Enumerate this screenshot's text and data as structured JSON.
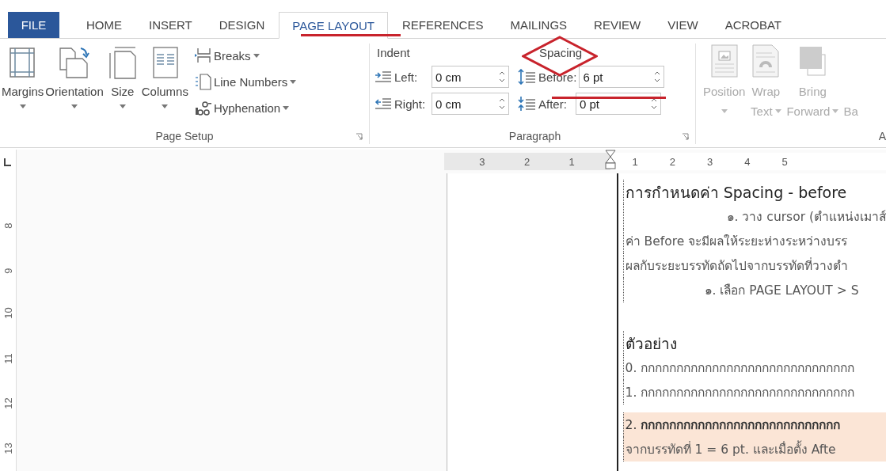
{
  "tabs": [
    {
      "label": "FILE",
      "kind": "file",
      "selected": false
    },
    {
      "label": "HOME",
      "kind": "tab",
      "selected": false
    },
    {
      "label": "INSERT",
      "kind": "tab",
      "selected": false
    },
    {
      "label": "DESIGN",
      "kind": "tab",
      "selected": false
    },
    {
      "label": "PAGE LAYOUT",
      "kind": "tab",
      "selected": true
    },
    {
      "label": "REFERENCES",
      "kind": "tab",
      "selected": false
    },
    {
      "label": "MAILINGS",
      "kind": "tab",
      "selected": false
    },
    {
      "label": "REVIEW",
      "kind": "tab",
      "selected": false
    },
    {
      "label": "VIEW",
      "kind": "tab",
      "selected": false
    },
    {
      "label": "ACROBAT",
      "kind": "tab",
      "selected": false
    }
  ],
  "page_setup": {
    "big_buttons": [
      {
        "label": "Margins",
        "kind": "margins"
      },
      {
        "label": "Orientation",
        "kind": "orientation"
      },
      {
        "label": "Size",
        "kind": "size"
      },
      {
        "label": "Columns",
        "kind": "columns"
      }
    ],
    "small_buttons": [
      {
        "label": "Breaks",
        "kind": "breaks"
      },
      {
        "label": "Line Numbers",
        "kind": "line_numbers"
      },
      {
        "label": "Hyphenation",
        "kind": "hyphenation"
      }
    ],
    "group_label": "Page Setup"
  },
  "paragraph": {
    "indent_label": "Indent",
    "indent": [
      {
        "label": "Left:",
        "value": "0 cm",
        "kind": "left"
      },
      {
        "label": "Right:",
        "value": "0 cm",
        "kind": "right"
      }
    ],
    "spacing_label": "Spacing",
    "spacing": [
      {
        "label": "Before:",
        "value": "6 pt",
        "kind": "before"
      },
      {
        "label": "After:",
        "value": "0 pt",
        "kind": "after"
      }
    ],
    "group_label": "Paragraph"
  },
  "arrange": {
    "buttons": [
      {
        "line1": "Position",
        "kind": "position",
        "disabled": true
      },
      {
        "line1": "Wrap",
        "line2": "Text",
        "kind": "wrap",
        "disabled": true
      },
      {
        "line1": "Bring",
        "line2": "Forward",
        "kind": "bring",
        "disabled": true
      },
      {
        "line2": "Ba",
        "kind": "cut",
        "disabled": true
      }
    ],
    "group_label": "A"
  },
  "horizontal_ruler": {
    "left_numbers": [
      "3",
      "2",
      "1"
    ],
    "right_numbers": [
      "1",
      "2",
      "3",
      "4",
      "5"
    ]
  },
  "vertical_ruler": [
    "8",
    "9",
    "10",
    "11",
    "12",
    "13"
  ],
  "document": [
    {
      "kind": "heading",
      "text": "การกำหนดค่า Spacing - before"
    },
    {
      "kind": "indent_wide",
      "text": "๑. วาง cursor (ตำแหน่งเมาส์"
    },
    {
      "kind": "body",
      "text": "ค่า Before จะมีผลให้ระยะห่างระหว่างบรร"
    },
    {
      "kind": "body",
      "text": "ผลกับระยะบรรทัดถัดไปจากบรรทัดที่วางตำ"
    },
    {
      "kind": "indent",
      "text": "๑. เลือก PAGE LAYOUT > S"
    },
    {
      "kind": "heading_gap",
      "text": "ตัวอย่าง"
    },
    {
      "kind": "body",
      "text": "0. กกกกกกกกกกกกกกกกกกกกกกกกกกกกกก"
    },
    {
      "kind": "body",
      "text": "1. กกกกกกกกกกกกกกกกกกกกกกกกกกกกกก"
    },
    {
      "kind": "highlight_first",
      "text": "2. **กกกกกกกกกกกกกกกกกกกกกกกกกกกก**"
    },
    {
      "kind": "highlight",
      "text": "จากบรรทัดที่ 1 = 6 pt. และเมื่อตั้ง Afte"
    }
  ]
}
